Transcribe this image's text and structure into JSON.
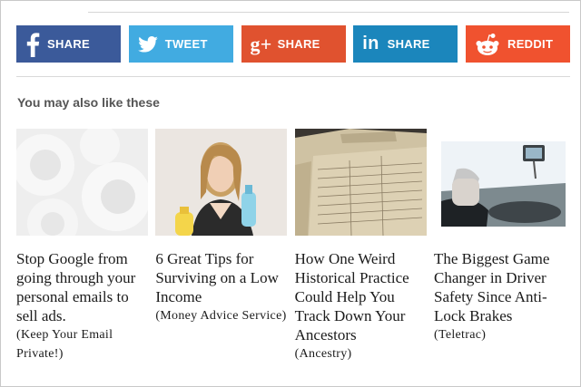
{
  "share": {
    "facebook": {
      "label": "SHARE",
      "icon": "facebook-icon",
      "color": "#3b5a9a"
    },
    "twitter": {
      "label": "TWEET",
      "icon": "twitter-icon",
      "color": "#41abe1"
    },
    "googleplus": {
      "label": "SHARE",
      "icon_text": "g+",
      "icon": "google-plus-icon",
      "color": "#e0522f"
    },
    "linkedin": {
      "label": "SHARE",
      "icon_text": "in",
      "icon": "linkedin-icon",
      "color": "#1b86bc"
    },
    "reddit": {
      "label": "REDDIT",
      "icon": "reddit-icon",
      "color": "#f0522f"
    }
  },
  "related": {
    "title": "You may also like these",
    "items": [
      {
        "title": "Stop Google from going through your personal emails to sell ads.",
        "source": "(Keep Your Email Private!)"
      },
      {
        "title": "6 Great Tips for Surviving on a Low Income",
        "source": "(Money Advice Service)"
      },
      {
        "title": "How One Weird Historical Practice Could Help You Track Down Your Ancestors",
        "source": "(Ancestry)"
      },
      {
        "title": "The Biggest Game Changer in Driver Safety Since Anti-Lock Brakes",
        "source": "(Teletrac)"
      }
    ]
  }
}
